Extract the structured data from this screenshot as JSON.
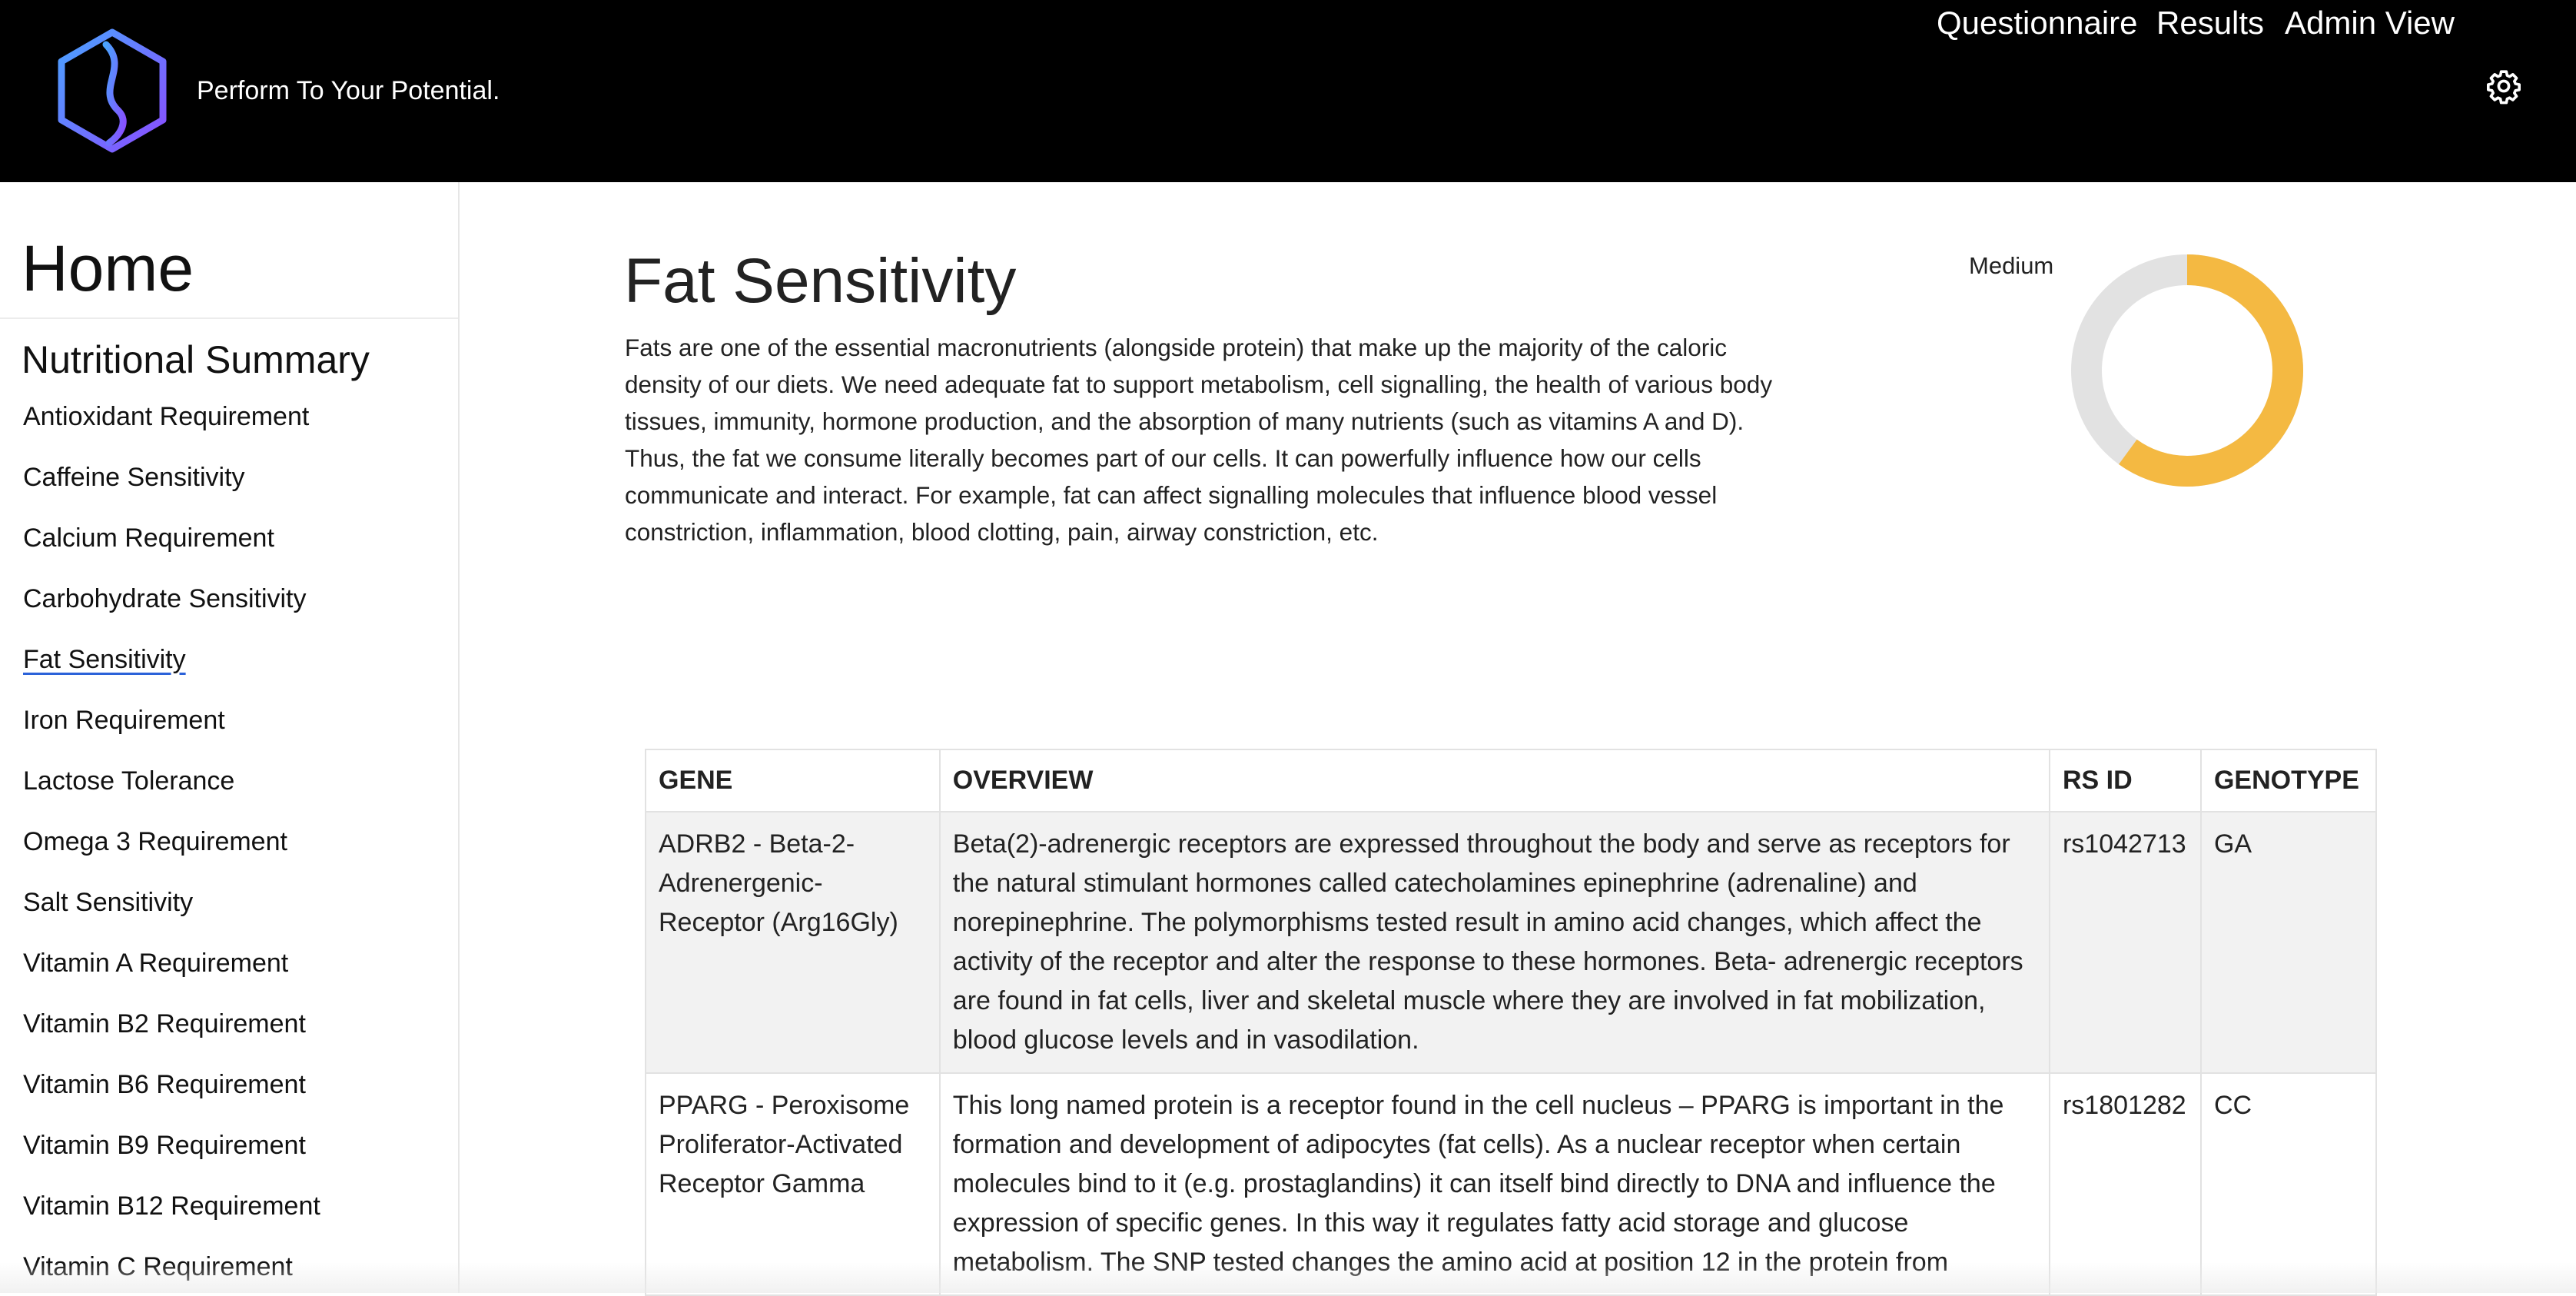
{
  "header": {
    "tagline": "Perform To Your Potential.",
    "nav": [
      {
        "label": "Questionnaire"
      },
      {
        "label": "Results"
      },
      {
        "label": "Admin View"
      }
    ],
    "settings_icon": "gear-icon",
    "logo_icon": "dna-hexagon-logo",
    "colors": {
      "background": "#000000",
      "logo_gradient_start": "#4aa3ff",
      "logo_gradient_end": "#8a4dff"
    }
  },
  "sidebar": {
    "home_label": "Home",
    "section_label": "Nutritional Summary",
    "items": [
      {
        "label": "Antioxidant Requirement"
      },
      {
        "label": "Caffeine Sensitivity"
      },
      {
        "label": "Calcium Requirement"
      },
      {
        "label": "Carbohydrate Sensitivity"
      },
      {
        "label": "Fat Sensitivity",
        "active": true
      },
      {
        "label": "Iron Requirement"
      },
      {
        "label": "Lactose Tolerance"
      },
      {
        "label": "Omega 3 Requirement"
      },
      {
        "label": "Salt Sensitivity"
      },
      {
        "label": "Vitamin A Requirement"
      },
      {
        "label": "Vitamin B2 Requirement"
      },
      {
        "label": "Vitamin B6 Requirement"
      },
      {
        "label": "Vitamin B9 Requirement"
      },
      {
        "label": "Vitamin B12 Requirement"
      },
      {
        "label": "Vitamin C Requirement"
      }
    ]
  },
  "main": {
    "title": "Fat Sensitivity",
    "description": "Fats are one of the essential macronutrients (alongside protein) that make up the majority of the caloric density of our diets. We need adequate fat to support metabolism, cell signalling, the health of various body tissues, immunity, hormone production, and the absorption of many nutrients (such as vitamins A and D). Thus, the fat we consume literally becomes part of our cells. It can powerfully influence how our cells communicate and interact. For example, fat can affect signalling molecules that influence blood vessel constriction, inflammation, blood clotting, pain, airway constriction, etc.",
    "score": {
      "label": "Medium",
      "fraction": 0.6,
      "fill_color": "#f4b942",
      "track_color": "#e2e2e2"
    }
  },
  "table": {
    "headers": {
      "gene": "GENE",
      "overview": "OVERVIEW",
      "rsid": "RS ID",
      "genotype": "GENOTYPE"
    },
    "rows": [
      {
        "gene": "ADRB2 - Beta-2-Adrenergenic-Receptor (Arg16Gly)",
        "overview": "Beta(2)-adrenergic receptors are expressed throughout the body and serve as receptors for the natural stimulant hormones called catecholamines epinephrine (adrenaline) and norepinephrine. The polymorphisms tested result in amino acid changes, which affect the activity of the receptor and alter the response to these hormones. Beta- adrenergic receptors are found in fat cells, liver and skeletal muscle where they are involved in fat mobilization, blood glucose levels and in vasodilation.",
        "rsid": "rs1042713",
        "genotype": "GA"
      },
      {
        "gene": "PPARG - Peroxisome Proliferator-Activated Receptor Gamma",
        "overview": "This long named protein is a receptor found in the cell nucleus – PPARG is important in the formation and development of adipocytes (fat cells). As a nuclear receptor when certain molecules bind to it (e.g. prostaglandins) it can itself bind directly to DNA and influence the expression of specific genes. In this way it regulates fatty acid storage and glucose metabolism. The SNP tested changes the amino acid at position 12 in the protein from",
        "rsid": "rs1801282",
        "genotype": "CC"
      }
    ]
  }
}
